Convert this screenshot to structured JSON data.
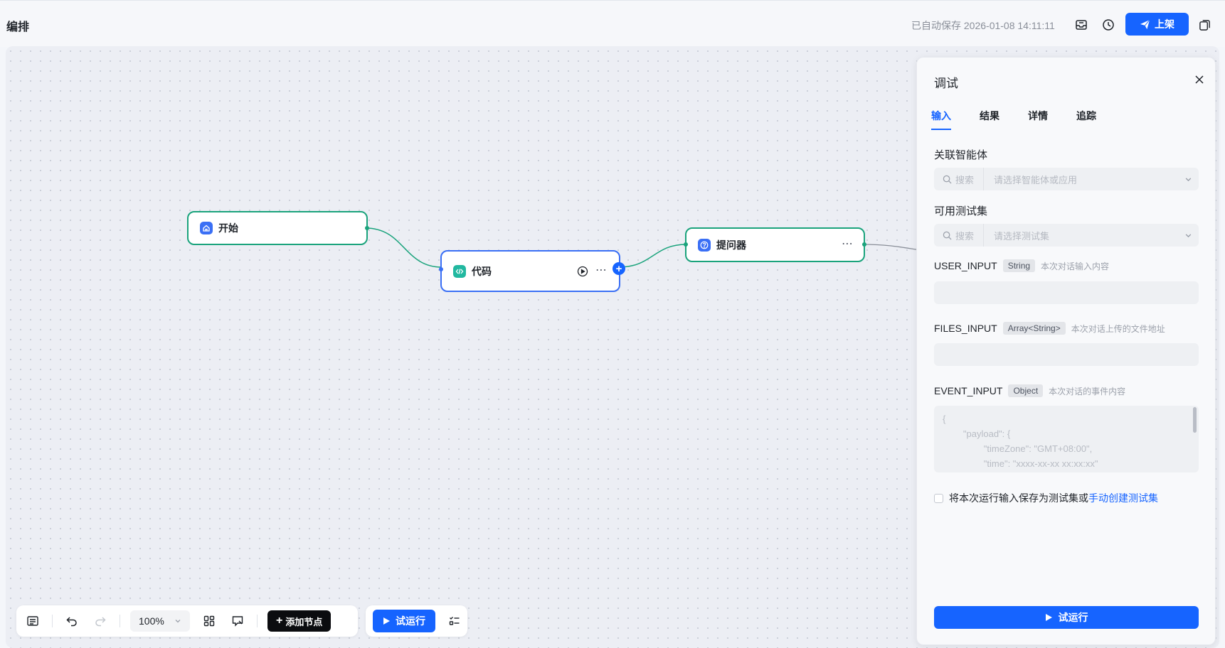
{
  "header": {
    "title": "编排",
    "autosave_text": "已自动保存 2026-01-08 14:11:11",
    "publish_label": "上架"
  },
  "nodes": {
    "start": "开始",
    "code": "代码",
    "asker": "提问器"
  },
  "toolbar": {
    "zoom": "100%",
    "add_node_label": "添加节点",
    "trial_run_label": "试运行"
  },
  "panel": {
    "title": "调试",
    "tabs": [
      {
        "label": "输入",
        "active": true
      },
      {
        "label": "结果",
        "active": false
      },
      {
        "label": "详情",
        "active": false
      },
      {
        "label": "追踪",
        "active": false
      }
    ],
    "agent_label": "关联智能体",
    "agent_search": "搜索",
    "agent_placeholder": "请选择智能体或应用",
    "testset_label": "可用测试集",
    "testset_search": "搜索",
    "testset_placeholder": "请选择测试集",
    "params": [
      {
        "name": "USER_INPUT",
        "type": "String",
        "desc": "本次对话输入内容"
      },
      {
        "name": "FILES_INPUT",
        "type": "Array<String>",
        "desc": "本次对话上传的文件地址"
      },
      {
        "name": "EVENT_INPUT",
        "type": "Object",
        "desc": "本次对话的事件内容"
      }
    ],
    "event_placeholder": "{\n        \"payload\": {\n                \"timeZone\": \"GMT+08:00\",\n                \"time\": \"xxxx-xx-xx xx:xx:xx\"",
    "save_text": "将本次运行输入保存为测试集或",
    "save_link": "手动创建测试集",
    "run_label": "试运行"
  },
  "colors": {
    "primary": "#1664ff",
    "node_border": "#1aa37c",
    "selected_border": "#3a6ff5"
  }
}
